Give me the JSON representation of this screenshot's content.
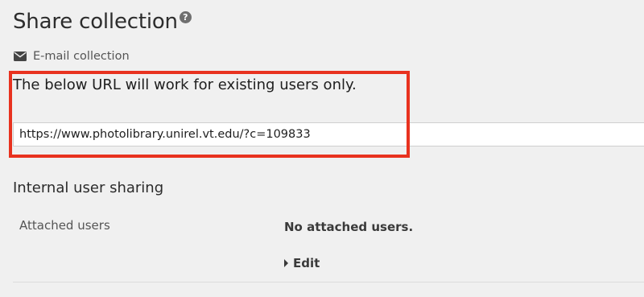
{
  "header": {
    "title": "Share collection",
    "help_icon": "question-circle-icon",
    "help_glyph": "?"
  },
  "email": {
    "label": "E-mail collection",
    "icon": "envelope-icon"
  },
  "url_section": {
    "notice": "The below URL will work for existing users only.",
    "url_value": "https://www.photolibrary.unirel.vt.edu/?c=109833"
  },
  "internal_sharing": {
    "heading": "Internal user sharing",
    "attached_users_label": "Attached users",
    "attached_users_value": "No attached users.",
    "edit_label": "Edit",
    "edit_icon": "caret-right-icon"
  },
  "colors": {
    "highlight": "#e8321f",
    "background": "#f0f0f0"
  }
}
